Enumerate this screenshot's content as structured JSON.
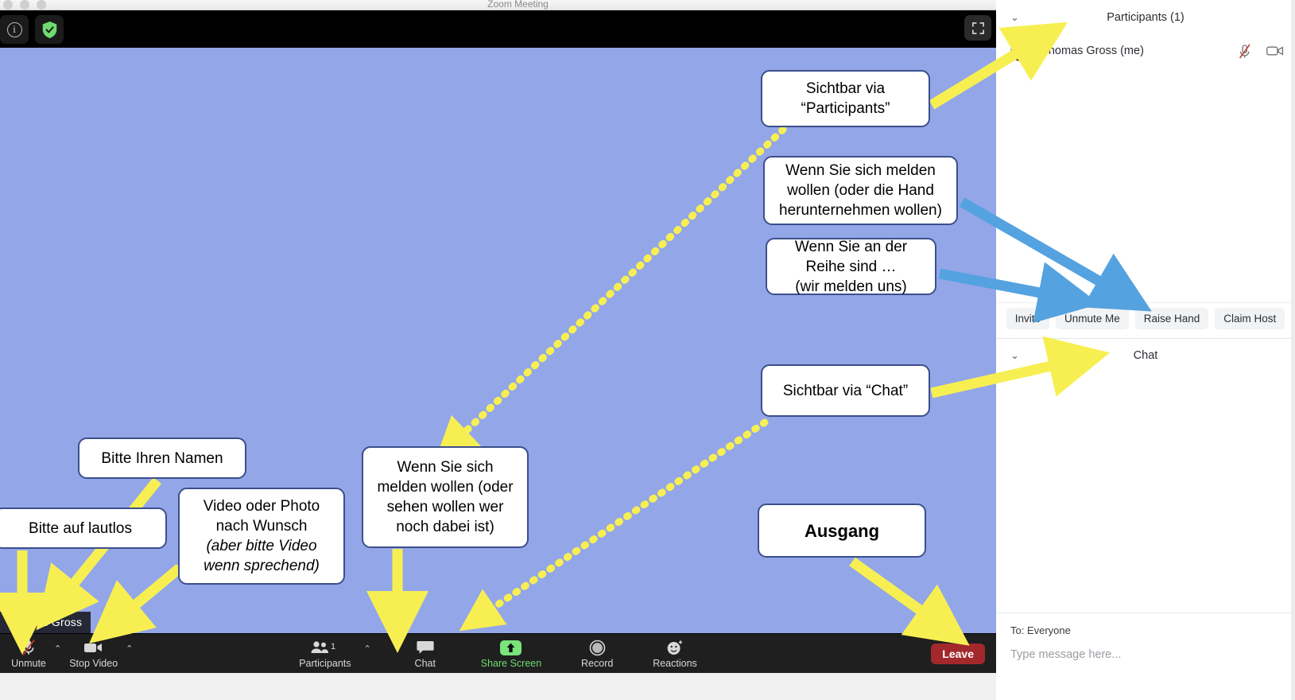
{
  "window": {
    "title": "Zoom Meeting",
    "info_icon": "info-icon",
    "shield_icon": "security-shield-icon",
    "fullscreen_icon": "fullscreen-icon"
  },
  "stage": {
    "self_name_label": "Thomas Gross"
  },
  "toolbar": {
    "mute": {
      "label": "Unmute",
      "icon": "microphone-muted-icon",
      "caret": "⌃"
    },
    "video": {
      "label": "Stop Video",
      "icon": "camera-icon",
      "caret": "⌃"
    },
    "participants": {
      "label": "Participants",
      "icon": "participants-icon",
      "count": "1",
      "caret": "⌃"
    },
    "chat": {
      "label": "Chat",
      "icon": "chat-bubble-icon"
    },
    "share": {
      "label": "Share Screen",
      "icon": "share-screen-arrow-icon"
    },
    "record": {
      "label": "Record",
      "icon": "record-circle-icon"
    },
    "reactions": {
      "label": "Reactions",
      "icon": "reactions-smiley-icon"
    },
    "leave": {
      "label": "Leave"
    }
  },
  "participants_panel": {
    "title": "Participants (1)",
    "collapse_chevron": "⌄",
    "rows": [
      {
        "name": "Thomas Gross (me)",
        "mic_icon": "microphone-muted-icon",
        "video_icon": "camera-icon"
      }
    ],
    "buttons": [
      "Invite",
      "Unmute Me",
      "Raise Hand",
      "Claim Host"
    ]
  },
  "chat_panel": {
    "title": "Chat",
    "collapse_chevron": "⌄",
    "to_label": "To: Everyone",
    "input_placeholder": "Type message here..."
  },
  "annotations": [
    {
      "id": "a1",
      "text": "Sichtbar via\n“Participants”"
    },
    {
      "id": "a2",
      "text": "Wenn Sie sich melden\nwollen (oder die Hand\nherunternehmen wollen)"
    },
    {
      "id": "a3",
      "text": "Wenn Sie an der\nReihe sind …\n(wir melden uns)"
    },
    {
      "id": "a4",
      "text": "Sichtbar via “Chat”"
    },
    {
      "id": "a5",
      "text": "Ausgang"
    },
    {
      "id": "a6",
      "text": "Bitte Ihren Namen"
    },
    {
      "id": "a7",
      "text": "Bitte auf lautlos"
    },
    {
      "id": "a8",
      "text": "Video oder Photo\nnach Wunsch"
    },
    {
      "id": "a8i",
      "text": "(aber bitte Video\nwenn sprechend)"
    },
    {
      "id": "a9",
      "text": "Wenn Sie sich\nmelden wollen (oder\nsehen wollen wer\nnoch dabei ist)"
    }
  ],
  "colors": {
    "stage_background": "#93a6e8",
    "arrow_yellow": "#f7ef52",
    "arrow_blue": "#54a2e0",
    "leave_red": "#a3282c",
    "share_green": "#79e37c",
    "callout_border": "#3c4f8c"
  }
}
